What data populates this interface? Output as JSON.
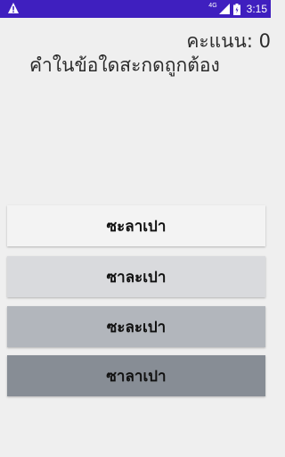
{
  "status_bar": {
    "warning_icon": "warning-icon",
    "network_type": "4G",
    "signal_icon": "cell-signal-icon",
    "battery_icon": "battery-icon",
    "time": "3:15",
    "background_color": "#3f1fbf"
  },
  "quiz": {
    "score_label": "คะแนน: 0",
    "question": "คำในข้อใดสะกดถูกต้อง",
    "choices": [
      {
        "label": "ซะลาเปา",
        "background_color": "#f3f3f3"
      },
      {
        "label": "ซาละเปา",
        "background_color": "#d9dadd"
      },
      {
        "label": "ซะละเปา",
        "background_color": "#b2b6bc"
      },
      {
        "label": "ซาลาเปา",
        "background_color": "#878d95"
      }
    ]
  }
}
